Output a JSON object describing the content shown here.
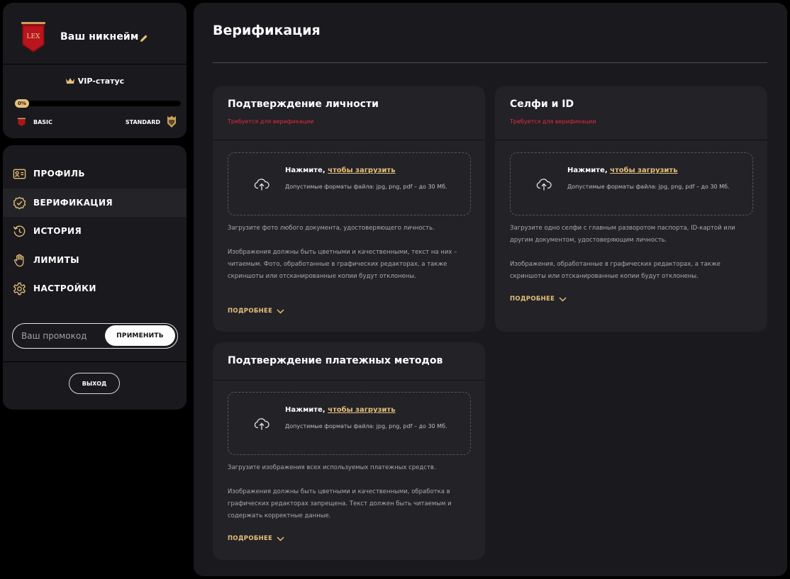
{
  "profile": {
    "nickname": "Ваш никнейм",
    "avatar_text": "LEX",
    "vip_label": "VIP-статус",
    "progress_label": "0%",
    "progress_fraction": 0,
    "tier_current": "BASIC",
    "tier_next": "STANDARD"
  },
  "nav": {
    "items": [
      {
        "label": "ПРОФИЛЬ",
        "icon": "profile-card-icon"
      },
      {
        "label": "ВЕРИФИКАЦИЯ",
        "icon": "verified-badge-icon"
      },
      {
        "label": "ИСТОРИЯ",
        "icon": "history-icon"
      },
      {
        "label": "ЛИМИТЫ",
        "icon": "hand-icon"
      },
      {
        "label": "НАСТРОЙКИ",
        "icon": "gear-icon"
      }
    ],
    "active_index": 1,
    "promo_placeholder": "Ваш промокод",
    "promo_button": "ПРИМЕНИТЬ",
    "logout": "ВЫХОД"
  },
  "main": {
    "title": "Верификация",
    "upload": {
      "prefix": "Нажмите, ",
      "link": "чтобы загрузить",
      "formats": "Допустимые форматы файла: jpg, png, pdf – до 30 Мб."
    },
    "more_label": "ПОДРОБНЕЕ",
    "cards": [
      {
        "title": "Подтверждение личности",
        "required": "Требуется для верификации",
        "paragraphs": [
          "Загрузите фото любого документа, удостоверяющего личность.",
          "Изображения должны быть цветными и качественными, текст на них – читаемым. Фото, обработанные в графических редакторах, а также скриншоты или отсканированные копии будут отклонены."
        ]
      },
      {
        "title": "Селфи и ID",
        "required": "Требуется для верификации",
        "paragraphs": [
          "Загрузите одно селфи с главным разворотом паспорта, ID-картой или другим документом, удостоверяющим личность.",
          "Изображения, обработанные в графических редакторах, а также скриншоты или отсканированные копии будут отклонены."
        ]
      },
      {
        "title": "Подтверждение платежных методов",
        "required": "",
        "paragraphs": [
          "Загрузите изображения всех используемых платежных средств.",
          "Изображения должны быть цветными и качественными, обработка в графических редакторах запрещена. Текст должен быть читаемым и содержать корректные данные."
        ]
      }
    ]
  },
  "colors": {
    "accent_gold": "#e8c07a",
    "required_red": "#e8283c",
    "panel": "#1a1a1e",
    "card": "#222227"
  }
}
